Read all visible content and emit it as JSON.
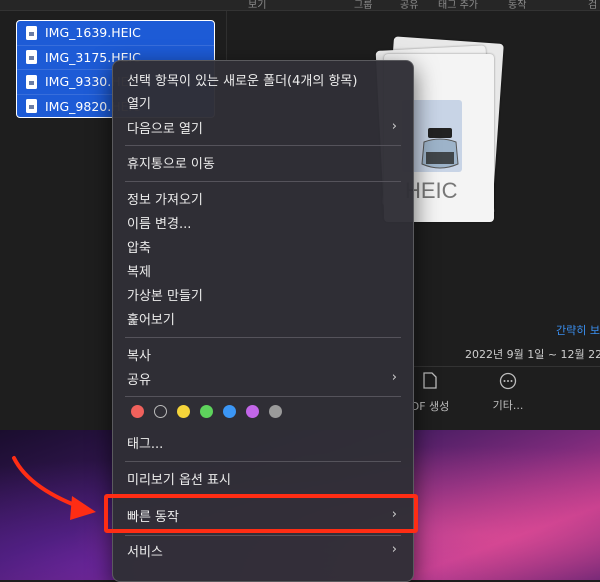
{
  "header": {
    "columns": [
      "보기",
      "그룹",
      "공유",
      "태그 추가",
      "동작",
      "검"
    ]
  },
  "files": [
    {
      "name": "IMG_1639.HEIC"
    },
    {
      "name": "IMG_3175.HEIC"
    },
    {
      "name": "IMG_9330.HEIC"
    },
    {
      "name": "IMG_9820.HEIC"
    }
  ],
  "preview": {
    "type_label": "HEIC",
    "more_link": "간략히 보",
    "date_range": "2022년 9월 1일 ~ 12월 22",
    "actions": [
      {
        "label": "DF 생성",
        "icon": "document-icon"
      },
      {
        "label": "기타...",
        "icon": "more-icon"
      }
    ]
  },
  "menu": {
    "items": [
      {
        "label": "선택 항목이 있는 새로운 폴더(4개의 항목)"
      },
      {
        "label": "열기"
      },
      {
        "label": "다음으로 열기",
        "submenu": true
      },
      {
        "label": "휴지통으로 이동"
      },
      {
        "label": "정보 가져오기"
      },
      {
        "label": "이름 변경..."
      },
      {
        "label": "압축"
      },
      {
        "label": "복제"
      },
      {
        "label": "가상본 만들기"
      },
      {
        "label": "훑어보기"
      },
      {
        "label": "복사"
      },
      {
        "label": "공유",
        "submenu": true
      },
      {
        "label": "태그..."
      },
      {
        "label": "미리보기 옵션 표시"
      },
      {
        "label": "빠른 동작",
        "submenu": true
      },
      {
        "label": "서비스",
        "submenu": true
      }
    ],
    "tag_colors": [
      "#f0615c",
      "none",
      "#f5d43a",
      "#5ed35c",
      "#3b96f5",
      "#c266e8",
      "#9a9a9a"
    ],
    "highlight_color": "#ff2d14"
  }
}
